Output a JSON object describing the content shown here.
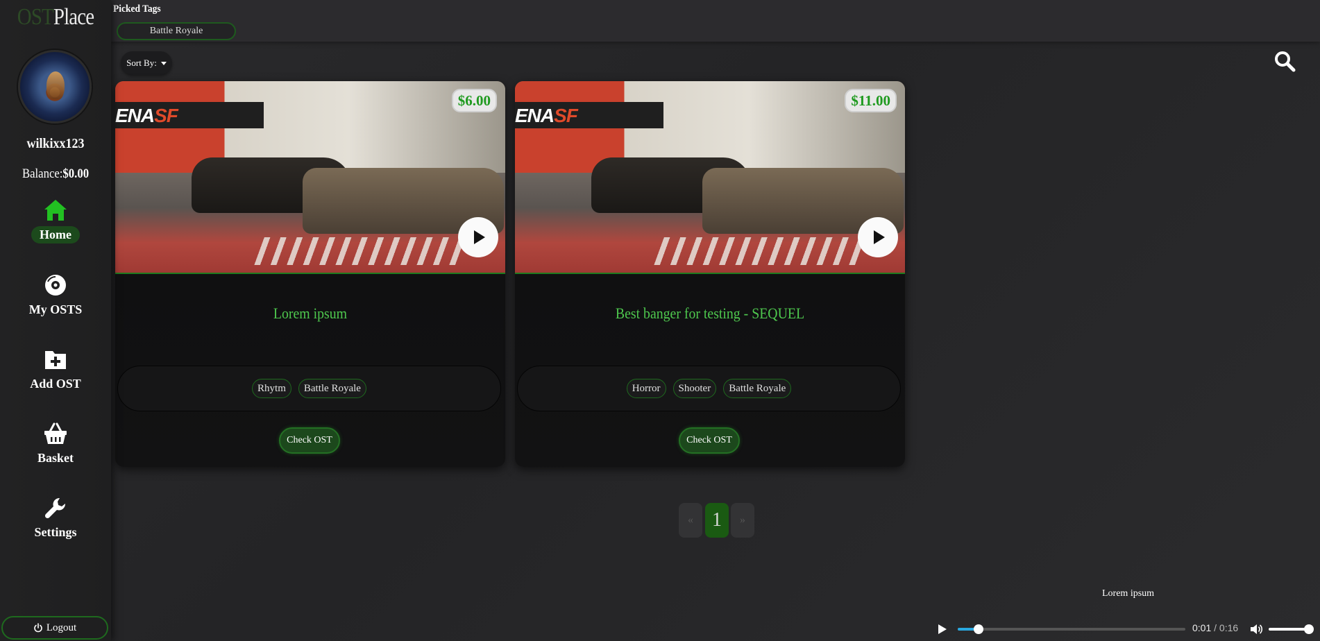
{
  "app": {
    "logo_ost": "OST",
    "logo_place": "Place"
  },
  "user": {
    "username": "wilkixx123",
    "balance_label": "Balance:",
    "balance_value": "$0.00"
  },
  "sidebar": {
    "items": [
      {
        "label": "Home",
        "icon": "home-icon",
        "active": true
      },
      {
        "label": "My OSTS",
        "icon": "disc-icon",
        "active": false
      },
      {
        "label": "Add OST",
        "icon": "folder-plus-icon",
        "active": false
      },
      {
        "label": "Basket",
        "icon": "basket-icon",
        "active": false
      },
      {
        "label": "Settings",
        "icon": "wrench-icon",
        "active": false
      }
    ],
    "logout_label": "Logout"
  },
  "filters": {
    "picked_title": "Picked Tags",
    "picked_tags": [
      "Battle Royale"
    ],
    "sort_label": "Sort By:"
  },
  "cards": [
    {
      "title": "Lorem ipsum",
      "price": "$6.00",
      "tags": [
        "Rhytm",
        "Battle Royale"
      ],
      "button": "Check OST"
    },
    {
      "title": "Best banger for testing - SEQUEL",
      "price": "$11.00",
      "tags": [
        "Horror",
        "Shooter",
        "Battle Royale"
      ],
      "button": "Check OST"
    }
  ],
  "pagination": {
    "prev": "«",
    "current": "1",
    "next": "»"
  },
  "player": {
    "track_title": "Lorem ipsum",
    "current_time": "0:01",
    "separator": " / ",
    "duration": "0:16",
    "progress_fraction": 0.0625,
    "volume_fraction": 1.0
  },
  "colors": {
    "accent_green": "#1f9a1f",
    "active_icon_green": "#22c022",
    "title_green": "#4ec84e",
    "seek_blue": "#29a8e0"
  }
}
